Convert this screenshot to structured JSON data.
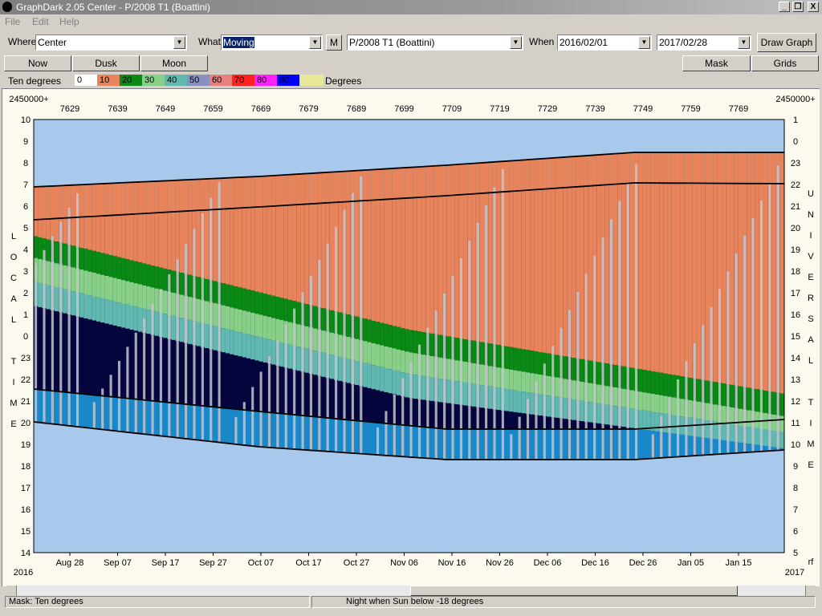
{
  "window": {
    "title": "GraphDark 2.05  Center  -  P/2008 T1 (Boattini)",
    "buttons": {
      "minimize": "_",
      "restore": "❐",
      "close": "X"
    }
  },
  "menu": [
    "File",
    "Edit",
    "Help"
  ],
  "toolbar": {
    "where_label": "Where",
    "where_value": "Center",
    "what_label": "What",
    "what_value": "Moving",
    "m_button": "M",
    "object_value": "P/2008 T1 (Boattini)",
    "when_label": "When",
    "start_date": "2016/02/01",
    "end_date": "2017/02/28",
    "draw_button": "Draw Graph"
  },
  "buttons_row": {
    "now": "Now",
    "dusk": "Dusk",
    "moon": "Moon",
    "mask": "Mask",
    "grids": "Grids"
  },
  "legend": {
    "label": "Ten degrees",
    "unit": "Degrees",
    "items": [
      {
        "text": "0",
        "color": "#ffffff"
      },
      {
        "text": "10",
        "color": "#e8845c"
      },
      {
        "text": "20",
        "color": "#0a8a14"
      },
      {
        "text": "30",
        "color": "#88d088"
      },
      {
        "text": "40",
        "color": "#60b8b0"
      },
      {
        "text": "50",
        "color": "#8890c0"
      },
      {
        "text": "60",
        "color": "#e88080"
      },
      {
        "text": "70",
        "color": "#ff2020"
      },
      {
        "text": "80",
        "color": "#ff20ff"
      },
      {
        "text": "90",
        "color": "#0000ff"
      },
      {
        "text": "",
        "color": "#e8e898"
      }
    ]
  },
  "chart_data": {
    "type": "area",
    "jd_prefix": "2450000+",
    "jd_ticks": [
      "7629",
      "7639",
      "7649",
      "7659",
      "7669",
      "7679",
      "7689",
      "7699",
      "7709",
      "7719",
      "7729",
      "7739",
      "7749",
      "7759",
      "7769"
    ],
    "date_ticks": [
      "Aug 28",
      "Sep 07",
      "Sep 17",
      "Sep 27",
      "Oct 07",
      "Oct 17",
      "Oct 27",
      "Nov 06",
      "Nov 16",
      "Nov 26",
      "Dec 06",
      "Dec 16",
      "Dec 26",
      "Jan 05",
      "Jan 15"
    ],
    "year_left": "2016",
    "year_right": "2017",
    "right_corner_label": "rf",
    "left_axis_ticks": [
      "10",
      "9",
      "8",
      "7",
      "6",
      "5",
      "4",
      "3",
      "2",
      "1",
      "0",
      "23",
      "22",
      "21",
      "20",
      "19",
      "18",
      "17",
      "16",
      "15",
      "14"
    ],
    "right_axis_ticks": [
      "1",
      "0",
      "23",
      "22",
      "21",
      "20",
      "19",
      "18",
      "17",
      "16",
      "15",
      "14",
      "13",
      "12",
      "11",
      "10",
      "9",
      "8",
      "7",
      "6",
      "5"
    ],
    "left_axis_title": [
      "L",
      "O",
      "C",
      "A",
      "L",
      "",
      "T",
      "I",
      "M",
      "E"
    ],
    "right_axis_title": [
      "U",
      "N",
      "I",
      "V",
      "E",
      "R",
      "S",
      "A",
      "L",
      "",
      "T",
      "I",
      "M",
      "E"
    ],
    "colors": {
      "day": "#a8c8ec",
      "twilight": "#1a88c8",
      "night": "#05053e",
      "moon": "#c4c4cc",
      "alt10": "#e8845c",
      "alt20": "#0a8a14",
      "alt30": "#88d088",
      "alt40": "#60b8b0"
    }
  },
  "status": {
    "mask": "Mask:  Ten degrees",
    "night": "Night when Sun below -18 degrees"
  }
}
